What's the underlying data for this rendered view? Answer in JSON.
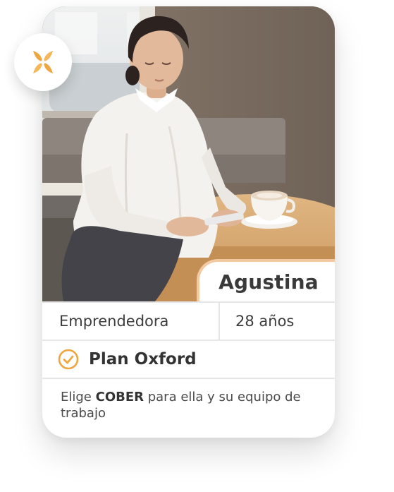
{
  "profile": {
    "name": "Agustina",
    "occupation": "Emprendedora",
    "age": "28 años",
    "plan": "Plan Oxford",
    "description_prefix": "Elige ",
    "description_brand": "COBER",
    "description_suffix": " para ella y su equipo de trabajo"
  },
  "icons": {
    "logo": "cober-logo-icon",
    "plan_check": "check-circle-icon"
  },
  "colors": {
    "accent": "#f0a640",
    "accent_light": "#f2c9a0",
    "text_dark": "#333333",
    "divider": "#e6e6e6"
  }
}
